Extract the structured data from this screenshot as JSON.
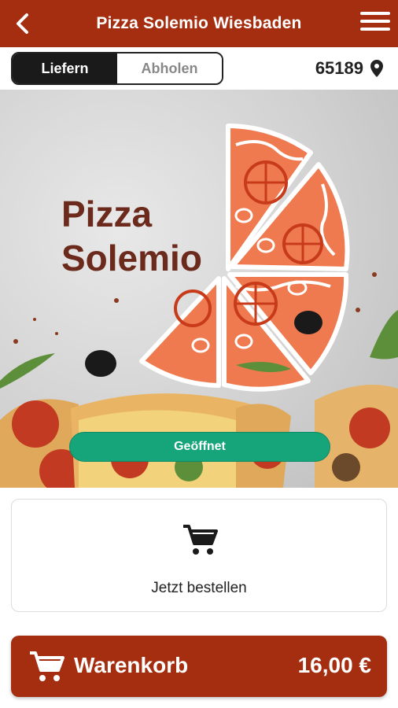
{
  "header": {
    "title": "Pizza Solemio Wiesbaden"
  },
  "delivery_mode": {
    "options": [
      "Liefern",
      "Abholen"
    ],
    "selected": "Liefern"
  },
  "location": {
    "zip": "65189"
  },
  "hero": {
    "brand_line1": "Pizza",
    "brand_line2": "Solemio",
    "status_label": "Geöffnet"
  },
  "order": {
    "label": "Jetzt bestellen"
  },
  "basket": {
    "label": "Warenkorb",
    "total": "16,00 €"
  },
  "colors": {
    "primary": "#a42e0f",
    "status_open": "#16a47a",
    "brand_text": "#6b2a1c",
    "pizza_art": "#f07a4f"
  }
}
